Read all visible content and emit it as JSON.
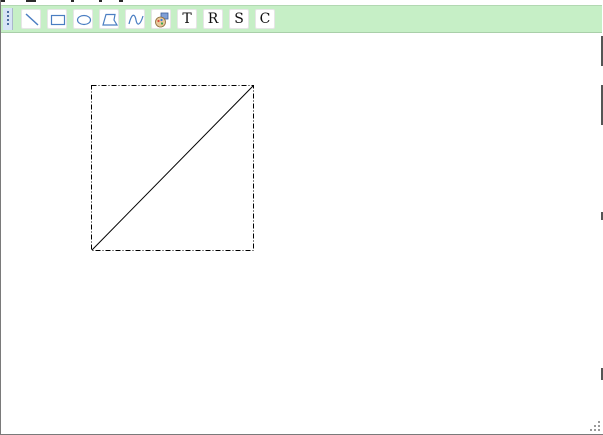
{
  "toolbar": {
    "tools": [
      {
        "name": "line-tool",
        "icon": "line-icon"
      },
      {
        "name": "rectangle-tool",
        "icon": "rectangle-icon"
      },
      {
        "name": "ellipse-tool",
        "icon": "ellipse-icon"
      },
      {
        "name": "polygon-tool",
        "icon": "polygon-icon"
      },
      {
        "name": "curve-tool",
        "icon": "curve-icon"
      },
      {
        "name": "color-tool",
        "icon": "palette-icon"
      }
    ],
    "text_buttons": {
      "t_label": "T",
      "r_label": "R",
      "s_label": "S",
      "c_label": "C"
    }
  },
  "drawing": {
    "shapes": [
      "diagonal-line"
    ],
    "selection": "dash-dot"
  },
  "colors": {
    "toolbar_bg": "#c6efc6",
    "icon_stroke": "#4a7ec2",
    "canvas_bg": "#ffffff",
    "shape_stroke": "#000000"
  }
}
